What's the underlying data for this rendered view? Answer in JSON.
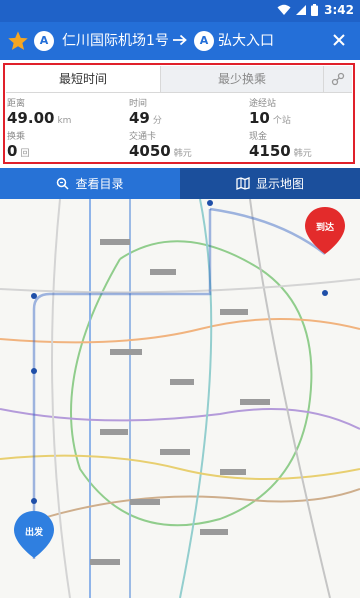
{
  "status_bar": {
    "time": "3:42"
  },
  "route": {
    "from_badge": "A",
    "from": "仁川国际机场1号...",
    "to_badge": "A",
    "to": "弘大入口"
  },
  "tabs": {
    "fastest": "最短时间",
    "fewest_transfers": "最少换乘"
  },
  "stats": {
    "distance": {
      "label": "距离",
      "value": "49.00",
      "unit": "km"
    },
    "time": {
      "label": "时间",
      "value": "49",
      "unit": "分"
    },
    "stations": {
      "label": "途经站",
      "value": "10",
      "unit": "个站"
    },
    "transfers": {
      "label": "换乘",
      "value": "0",
      "unit": "回"
    },
    "card_fare": {
      "label": "交通卡",
      "value": "4050",
      "unit": "韩元"
    },
    "cash_fare": {
      "label": "现金",
      "value": "4150",
      "unit": "韩元"
    }
  },
  "actions": {
    "view_list": "查看目录",
    "show_map": "显示地图"
  },
  "map": {
    "arrive_label": "到达",
    "depart_label": "出发"
  },
  "colors": {
    "header": "#246fd8",
    "status_bar": "#1f62c8",
    "highlight_border": "#e0202a",
    "active_action": "#1b4f9c",
    "arrive_pin": "#e32b2b",
    "depart_pin": "#2f7fe0",
    "star": "#f5a623"
  },
  "icons": {
    "star": "star-icon",
    "arrow": "arrow-right-icon",
    "close": "close-icon",
    "swap": "swap-route-icon",
    "list": "search-list-icon",
    "map": "map-icon"
  }
}
